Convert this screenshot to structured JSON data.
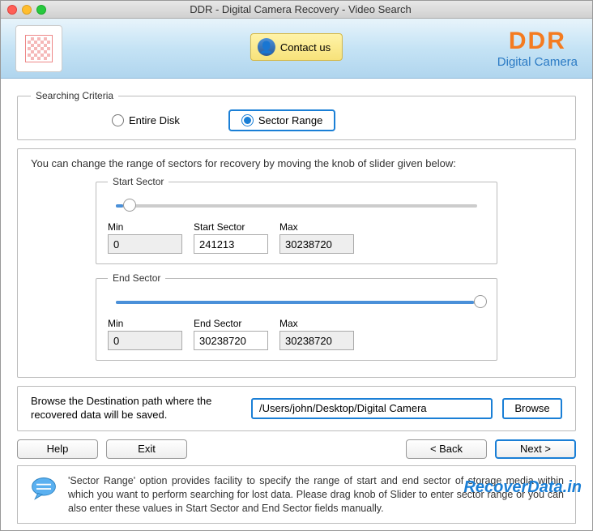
{
  "window": {
    "title": "DDR - Digital Camera Recovery - Video Search"
  },
  "header": {
    "contact_label": "Contact us",
    "brand": "DDR",
    "brand_sub": "Digital Camera"
  },
  "criteria": {
    "legend": "Searching Criteria",
    "entire_disk": "Entire Disk",
    "sector_range": "Sector Range"
  },
  "range_info": "You can change the range of sectors for recovery by moving the knob of slider given below:",
  "start": {
    "legend": "Start Sector",
    "min_label": "Min",
    "min_value": "0",
    "sector_label": "Start Sector",
    "sector_value": "241213",
    "max_label": "Max",
    "max_value": "30238720",
    "knob_percent": 2
  },
  "end": {
    "legend": "End Sector",
    "min_label": "Min",
    "min_value": "0",
    "sector_label": "End Sector",
    "sector_value": "30238720",
    "max_label": "Max",
    "max_value": "30238720",
    "knob_percent": 99
  },
  "dest": {
    "text": "Browse the Destination path where the recovered data will be saved.",
    "path": "/Users/john/Desktop/Digital Camera",
    "browse": "Browse"
  },
  "buttons": {
    "help": "Help",
    "exit": "Exit",
    "back": "< Back",
    "next": "Next >"
  },
  "help_text": "'Sector Range' option provides facility to specify the range of start and end sector of storage media within which you want to perform searching for lost data. Please drag knob of Slider to enter sector range or you can also enter these values in Start Sector and End Sector fields manually.",
  "watermark": "RecoverData.in"
}
